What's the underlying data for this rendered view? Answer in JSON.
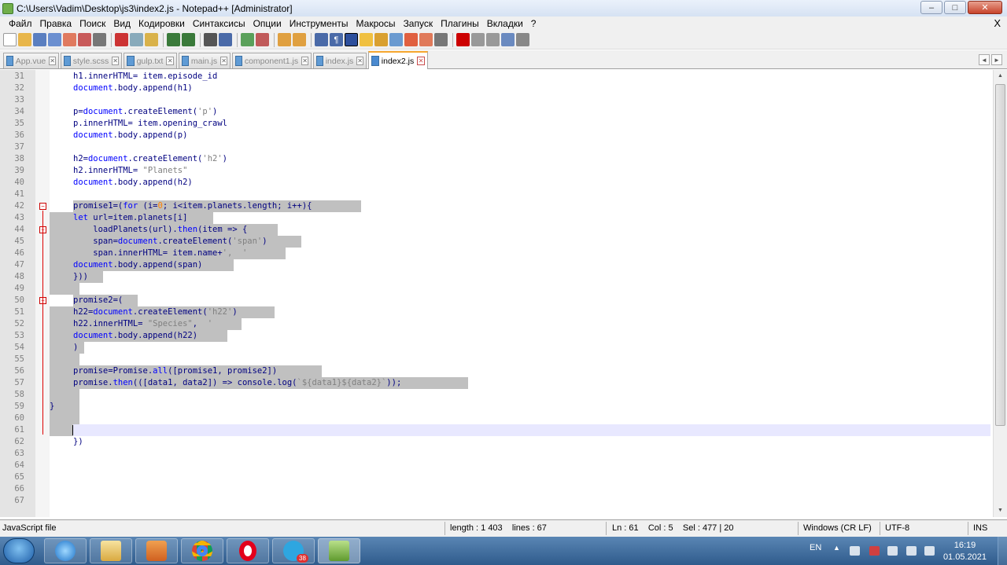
{
  "window": {
    "title": "C:\\Users\\Vadim\\Desktop\\js3\\index2.js - Notepad++ [Administrator]",
    "minimize": "–",
    "maximize": "□",
    "close": "✕"
  },
  "menu": {
    "items": [
      "Файл",
      "Правка",
      "Поиск",
      "Вид",
      "Кодировки",
      "Синтаксисы",
      "Опции",
      "Инструменты",
      "Макросы",
      "Запуск",
      "Плагины",
      "Вкладки",
      "?"
    ],
    "close": "X"
  },
  "tabs": [
    {
      "label": "App.vue",
      "active": false
    },
    {
      "label": "style.scss",
      "active": false
    },
    {
      "label": "gulp.txt",
      "active": false
    },
    {
      "label": "main.js",
      "active": false
    },
    {
      "label": "component1.js",
      "active": false
    },
    {
      "label": "index.js",
      "active": false
    },
    {
      "label": "index2.js",
      "active": true
    }
  ],
  "tab_close_glyph": "✕",
  "tab_nav": {
    "prev": "◄",
    "next": "►"
  },
  "editor": {
    "lines": [
      {
        "n": "31",
        "t": "h1.innerHTML= item.episode_id"
      },
      {
        "n": "32",
        "t": "document.body.append(h1)"
      },
      {
        "n": "33",
        "t": ""
      },
      {
        "n": "34",
        "t": "p=document.createElement('p')"
      },
      {
        "n": "35",
        "t": "p.innerHTML= item.opening_crawl"
      },
      {
        "n": "36",
        "t": "document.body.append(p)"
      },
      {
        "n": "37",
        "t": ""
      },
      {
        "n": "38",
        "t": "h2=document.createElement('h2')"
      },
      {
        "n": "39",
        "t": "h2.innerHTML= \"Planets\""
      },
      {
        "n": "40",
        "t": "document.body.append(h2)"
      },
      {
        "n": "41",
        "t": ""
      },
      {
        "n": "42",
        "t": "promise1=(for (i=0; i<item.planets.length; i++){"
      },
      {
        "n": "43",
        "t": "let url=item.planets[i]"
      },
      {
        "n": "44",
        "t": "    loadPlanets(url).then(item => {"
      },
      {
        "n": "45",
        "t": "    span=document.createElement('span')"
      },
      {
        "n": "46",
        "t": "    span.innerHTML= item.name+',  '"
      },
      {
        "n": "47",
        "t": "document.body.append(span)"
      },
      {
        "n": "48",
        "t": "}))"
      },
      {
        "n": "49",
        "t": ""
      },
      {
        "n": "50",
        "t": "promise2=("
      },
      {
        "n": "51",
        "t": "h22=document.createElement('h22')"
      },
      {
        "n": "52",
        "t": "h22.innerHTML= \"Species\",  '"
      },
      {
        "n": "53",
        "t": "document.body.append(h22)"
      },
      {
        "n": "54",
        "t": ")"
      },
      {
        "n": "55",
        "t": ""
      },
      {
        "n": "56",
        "t": "promise=Promise.all([promise1, promise2])"
      },
      {
        "n": "57",
        "t": "promise.then(([data1, data2]) => console.log(`${data1}${data2}`));"
      },
      {
        "n": "58",
        "t": ""
      },
      {
        "n": "59",
        "t": "}"
      },
      {
        "n": "60",
        "t": ""
      },
      {
        "n": "61",
        "t": ""
      },
      {
        "n": "62",
        "t": "})"
      },
      {
        "n": "63",
        "t": ""
      },
      {
        "n": "64",
        "t": ""
      },
      {
        "n": "65",
        "t": ""
      },
      {
        "n": "66",
        "t": ""
      },
      {
        "n": "67",
        "t": ""
      }
    ]
  },
  "status": {
    "filetype": "JavaScript file",
    "length": "length : 1 403    lines : 67",
    "position": "Ln : 61    Col : 5    Sel : 477 | 20",
    "eol": "Windows (CR LF)",
    "encoding": "UTF-8",
    "mode": "INS"
  },
  "taskbar": {
    "lang": "EN",
    "time": "16:19",
    "date": "01.05.2021",
    "telegram_badge": "38"
  },
  "colors": {
    "keyword": "#0000ff",
    "string": "#808080",
    "number": "#ff8000",
    "identifier": "#000080",
    "selection": "#c0c0c0",
    "current_line": "#e8e8ff"
  }
}
